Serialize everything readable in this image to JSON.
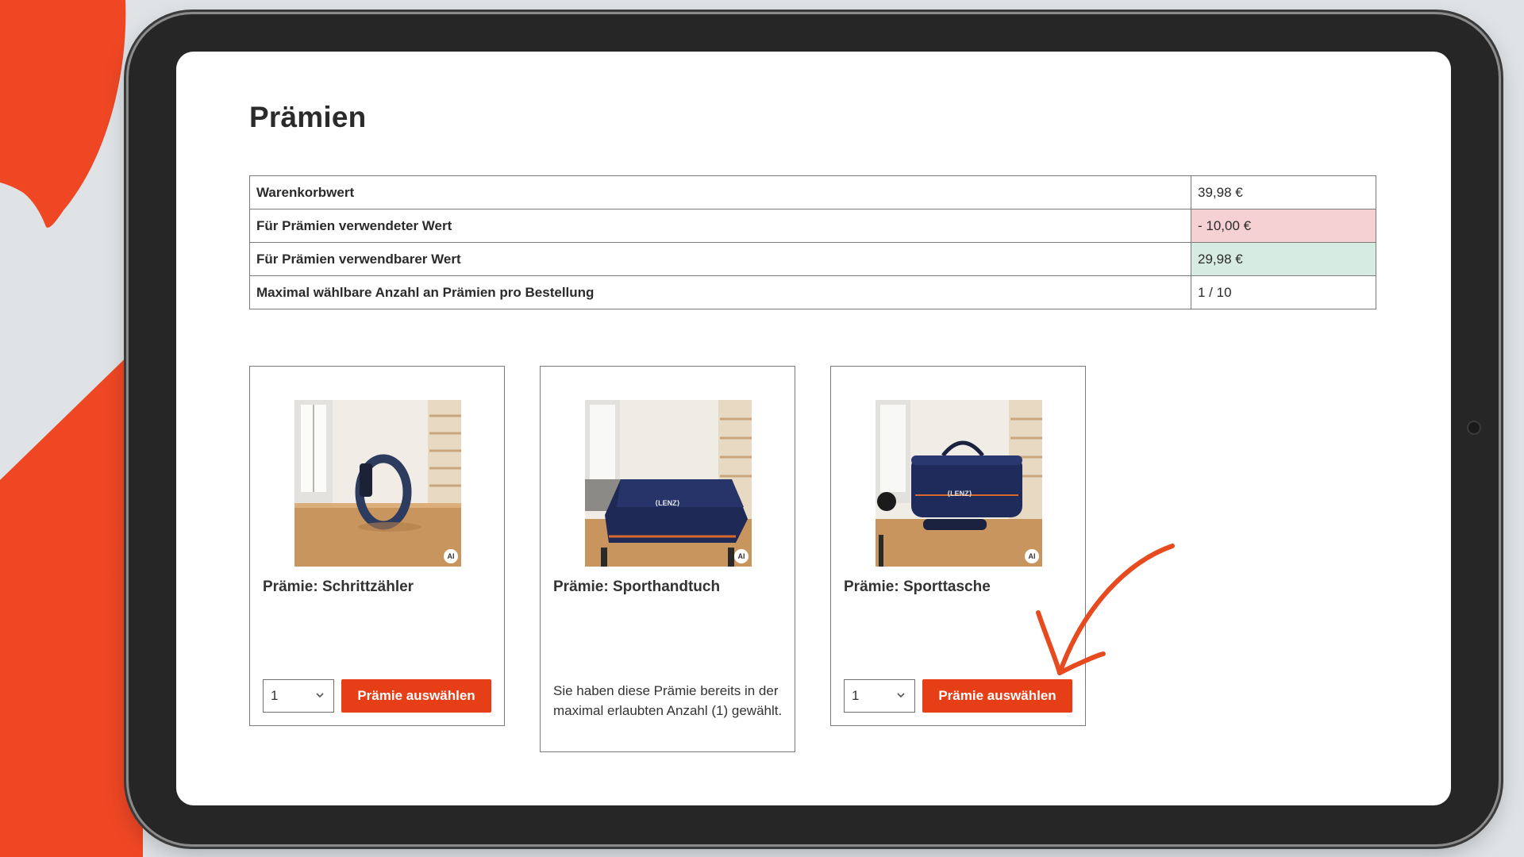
{
  "page": {
    "title": "Prämien"
  },
  "summary": [
    {
      "label": "Warenkorbwert",
      "value": "39,98 €",
      "highlight": "#ffffff"
    },
    {
      "label": "Für Prämien verwendeter Wert",
      "value": "- 10,00 €",
      "highlight": "#f6d1d3"
    },
    {
      "label": "Für Prämien verwendbarer Wert",
      "value": "29,98 €",
      "highlight": "#d6ebe1"
    },
    {
      "label": "Maximal wählbare Anzahl an Prämien pro Bestellung",
      "value": "1 / 10",
      "highlight": "#ffffff"
    }
  ],
  "rewards": [
    {
      "title": "Prämie: Schrittzähler",
      "quantity": "1",
      "button_label": "Prämie auswählen",
      "image_icon": "fitness-tracker",
      "badge": "AI"
    },
    {
      "title": "Prämie: Sporthandtuch",
      "note": "Sie haben diese Prämie bereits in der maximal erlaubten Anzahl (1) gewählt.",
      "image_icon": "towel",
      "badge": "AI",
      "logo_text": "⟨LENZ⟩"
    },
    {
      "title": "Prämie: Sporttasche",
      "quantity": "1",
      "button_label": "Prämie auswählen",
      "image_icon": "sports-bag",
      "badge": "AI",
      "logo_text": "⟨LENZ⟩"
    }
  ],
  "colors": {
    "accent": "#e63e16",
    "decor_orange": "#ef4724",
    "negative_bg": "#f6d1d3",
    "positive_bg": "#d6ebe1"
  }
}
